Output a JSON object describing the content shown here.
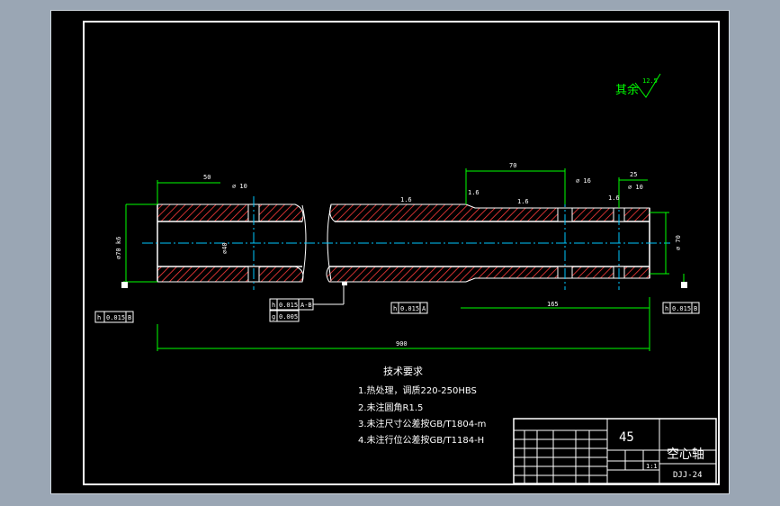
{
  "drawing": {
    "roughness_note": {
      "text": "其余",
      "value": "12.5"
    },
    "dimensions": {
      "left_length": "50",
      "left_hole": "⌀ 10",
      "left_od": "⌀70 k6",
      "left_bore": "⌀40",
      "top_70": "70",
      "hole_16": "⌀ 16",
      "dim_25": "25",
      "hole_10": "⌀ 10",
      "right_od": "⌀ 70",
      "span_165": "165",
      "total_length": "900",
      "roughness_a": "1.6",
      "roughness_b": "1.6",
      "roughness_c": "1.6",
      "roughness_d": "1.6"
    },
    "tolerance_frames": {
      "left": {
        "symbol": "h",
        "value": "0.015",
        "datum": "B"
      },
      "mid1": {
        "symbol": "h",
        "value": "0.015",
        "datum": "A-B"
      },
      "mid2": {
        "symbol": "g",
        "value": "0.005"
      },
      "center": {
        "symbol": "h",
        "value": "0.015",
        "datum": "A"
      },
      "right": {
        "symbol": "h",
        "value": "0.015",
        "datum": "B"
      }
    },
    "technical_requirements": {
      "title": "技术要求",
      "items": [
        "1.热处理，调质220-250HBS",
        "2.未注圆角R1.5",
        "3.未注尺寸公差按GB/T1804-m",
        "4.未注行位公差按GB/T1184-H"
      ]
    }
  },
  "title_block": {
    "material": "45",
    "part_name": "空心轴",
    "drawing_no": "DJJ-24",
    "scale": "1:1"
  },
  "colors": {
    "background": "#9aa6b4",
    "sheet": "#000000",
    "lines": "#ffffff",
    "dimension": "#00ff00",
    "hatch": "#ff3b3b",
    "centerline": "#00c8ff"
  }
}
